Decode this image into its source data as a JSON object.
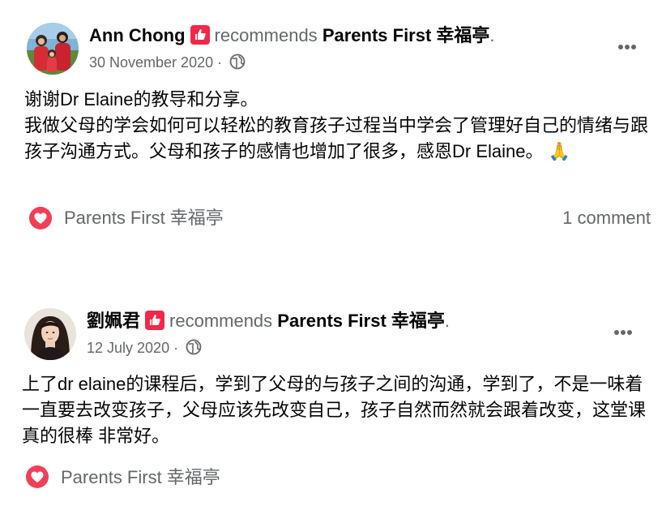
{
  "colors": {
    "text_primary": "#050505",
    "text_secondary": "#65676b",
    "badge": "#f02849",
    "heart": "#f33e58"
  },
  "posts": [
    {
      "author": "Ann Chong",
      "action": "recommends",
      "page": "Parents First 幸福亭",
      "period": ".",
      "date": "30 November 2020",
      "separator": " · ",
      "privacy_icon": "globe-icon",
      "body": "谢谢Dr Elaine的教导和分享。\n我做父母的学会如何可以轻松的教育孩子过程当中学会了管理好自己的情绪与跟孩子沟通方式。父母和孩子的感情也增加了很多，感恩Dr Elaine。 🙏",
      "reaction_icon": "heart-icon",
      "footer_page": "Parents First 幸福亭",
      "comments": "1 comment"
    },
    {
      "author": "劉姵君",
      "action": "recommends",
      "page": "Parents First 幸福亭",
      "period": ".",
      "date": "12 July 2020",
      "separator": " · ",
      "privacy_icon": "globe-icon",
      "body": "上了dr elaine的课程后，学到了父母的与孩子之间的沟通，学到了，不是一味着一直要去改变孩子，父母应该先改变自己，孩子自然而然就会跟着改变，这堂课真的很棒 非常好。",
      "reaction_icon": "heart-icon",
      "footer_page": "Parents First 幸福亭",
      "comments": ""
    }
  ]
}
